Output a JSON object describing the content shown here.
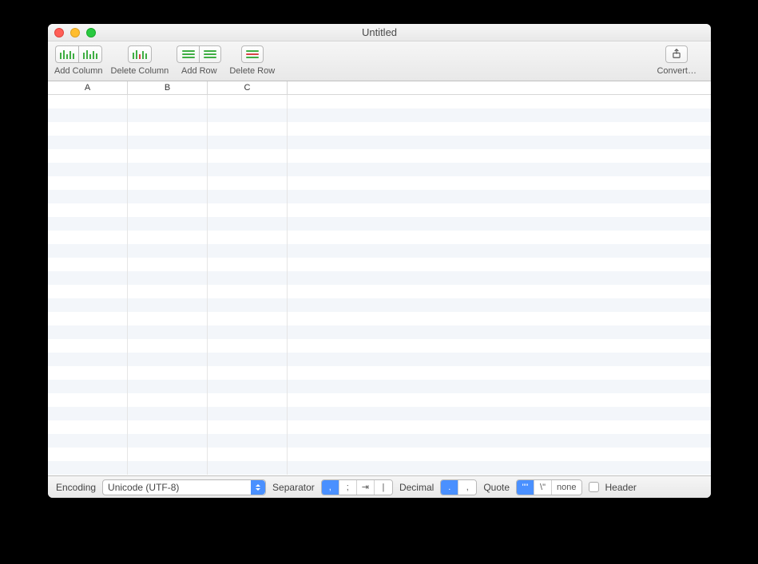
{
  "window": {
    "title": "Untitled"
  },
  "toolbar": {
    "add_column_label": "Add Column",
    "delete_column_label": "Delete Column",
    "add_row_label": "Add Row",
    "delete_row_label": "Delete Row",
    "convert_label": "Convert…"
  },
  "columns": [
    "A",
    "B",
    "C"
  ],
  "status": {
    "encoding_label": "Encoding",
    "encoding_value": "Unicode (UTF-8)",
    "separator_label": "Separator",
    "separator_options": [
      ",",
      ";",
      "⇥",
      "|"
    ],
    "separator_selected": ",",
    "decimal_label": "Decimal",
    "decimal_options": [
      ".",
      ","
    ],
    "decimal_selected": ".",
    "quote_label": "Quote",
    "quote_options": [
      "\"\"",
      "\\\"",
      "none"
    ],
    "quote_selected": "\"\"",
    "header_label": "Header",
    "header_checked": false
  }
}
